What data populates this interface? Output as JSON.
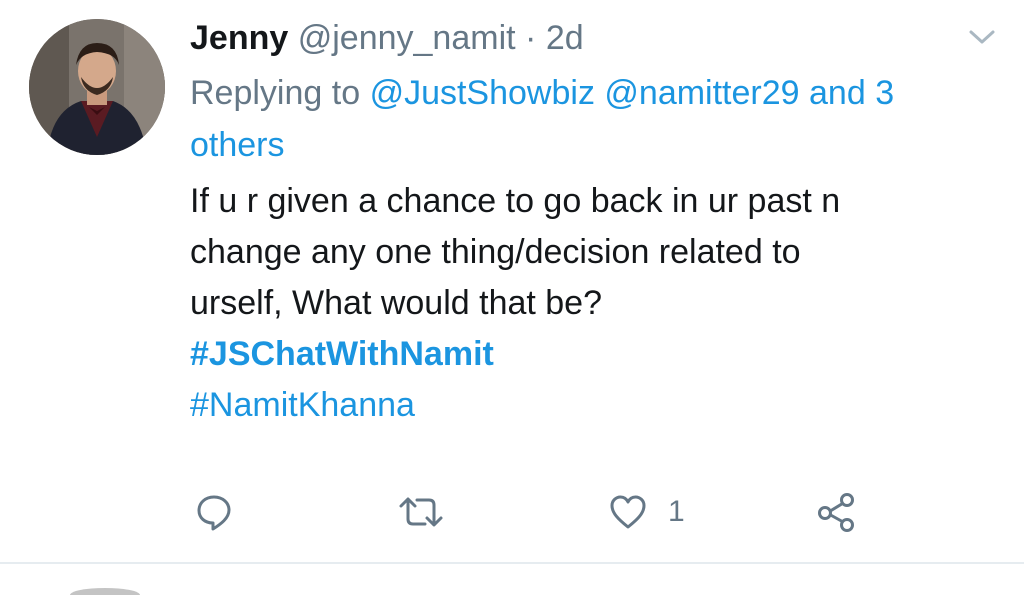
{
  "tweet": {
    "author_name": "Jenny",
    "author_handle": "@jenny_namit",
    "separator": "·",
    "time": "2d",
    "replying_prefix": "Replying to",
    "reply_mention_1": "@JustShowbiz",
    "reply_mention_2": "@namitter29",
    "reply_and": "and",
    "reply_others": "3 others",
    "body_lines": [
      "If u r given a chance to go back in ur past n",
      "change any one thing/decision related to",
      "urself, What would that be?"
    ],
    "hashtags": [
      "#JSChatWithNamit",
      "#NamitKhanna"
    ]
  },
  "actions": {
    "reply_icon": "reply-icon",
    "retweet_icon": "retweet-icon",
    "like_icon": "heart-icon",
    "like_count": "1",
    "share_icon": "share-icon"
  },
  "colors": {
    "link": "#1b95e0",
    "text": "#14171a",
    "secondary": "#657786",
    "divider": "#e6ecf0"
  }
}
